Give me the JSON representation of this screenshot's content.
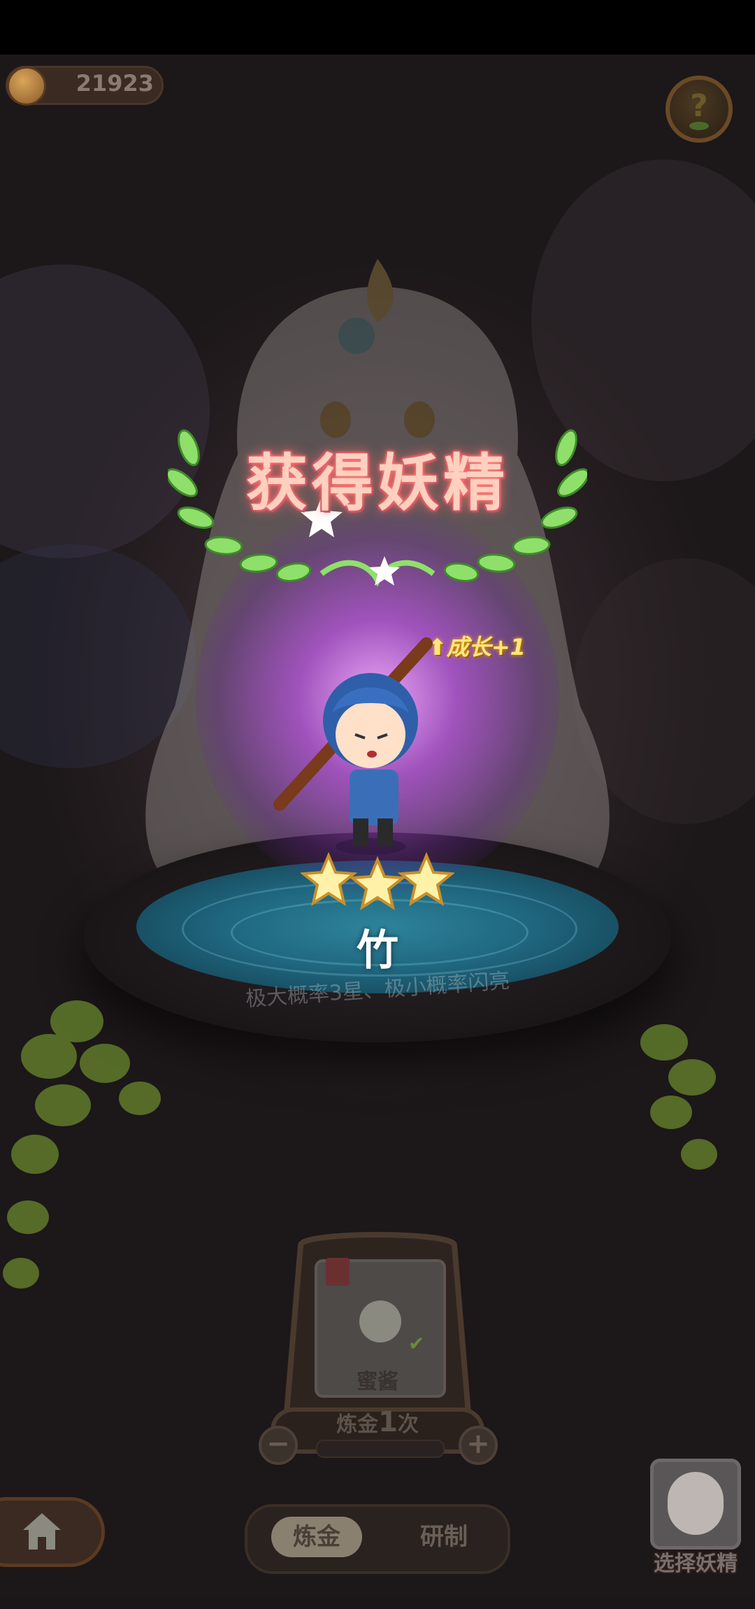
{
  "currency": {
    "value": "21923",
    "icon": "crown-coin-icon"
  },
  "help": {
    "icon": "question-mark-icon"
  },
  "result": {
    "title": "获得妖精",
    "growth_text": "成长+1",
    "growth_icon": "up-arrow-icon",
    "stars": 3,
    "fairy_name": "竹",
    "probability_text": "极大概率3星、极小概率闪亮"
  },
  "alchemy": {
    "recipe_card_label": "蜜酱",
    "count_prefix": "炼金",
    "count_value": "1",
    "count_suffix": "次",
    "minus_label": "−",
    "plus_label": "+"
  },
  "tabs": {
    "alchemy": "炼金",
    "research": "研制"
  },
  "select_fairy": {
    "label": "选择妖精"
  },
  "colors": {
    "glow": "#c060e0",
    "pool": "#2e8ea8",
    "title": "#ffd0c0",
    "growth": "#ffe680",
    "star": "#fff2a8"
  }
}
